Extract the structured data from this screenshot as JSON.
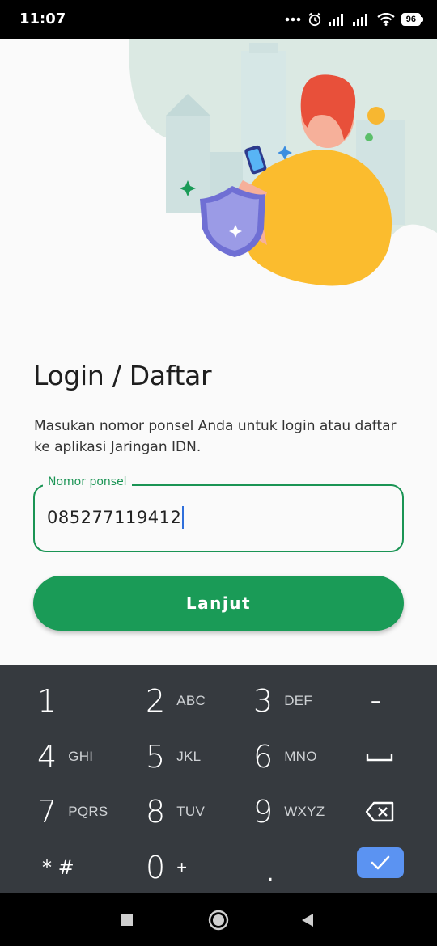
{
  "status_bar": {
    "time": "11:07",
    "battery": "96",
    "icons": [
      "more-dots-icon",
      "alarm-icon",
      "signal-icon",
      "signal-icon",
      "wifi-icon",
      "battery-icon"
    ]
  },
  "login": {
    "title": "Login / Daftar",
    "subtitle": "Masukan nomor ponsel Anda untuk login atau daftar ke aplikasi Jaringan IDN.",
    "phone_label": "Nomor ponsel",
    "phone_value": "085277119412",
    "continue_label": "Lanjut"
  },
  "colors": {
    "primary_green": "#1a9b57",
    "field_border": "#1a9454",
    "keypad_bg": "#363a3f",
    "done_key": "#5b93f2"
  },
  "keypad": {
    "keys": [
      {
        "digit": "1",
        "letters": ""
      },
      {
        "digit": "2",
        "letters": "ABC"
      },
      {
        "digit": "3",
        "letters": "DEF"
      },
      {
        "digit": "4",
        "letters": "GHI"
      },
      {
        "digit": "5",
        "letters": "JKL"
      },
      {
        "digit": "6",
        "letters": "MNO"
      },
      {
        "digit": "7",
        "letters": "PQRS"
      },
      {
        "digit": "8",
        "letters": "TUV"
      },
      {
        "digit": "9",
        "letters": "WXYZ"
      },
      {
        "digit": "0",
        "letters": "+"
      }
    ],
    "star_hash": "* #",
    "dot": ".",
    "minus": "–"
  },
  "nav_bar": {
    "buttons": [
      "recents-square-icon",
      "home-circle-icon",
      "back-triangle-icon"
    ]
  }
}
